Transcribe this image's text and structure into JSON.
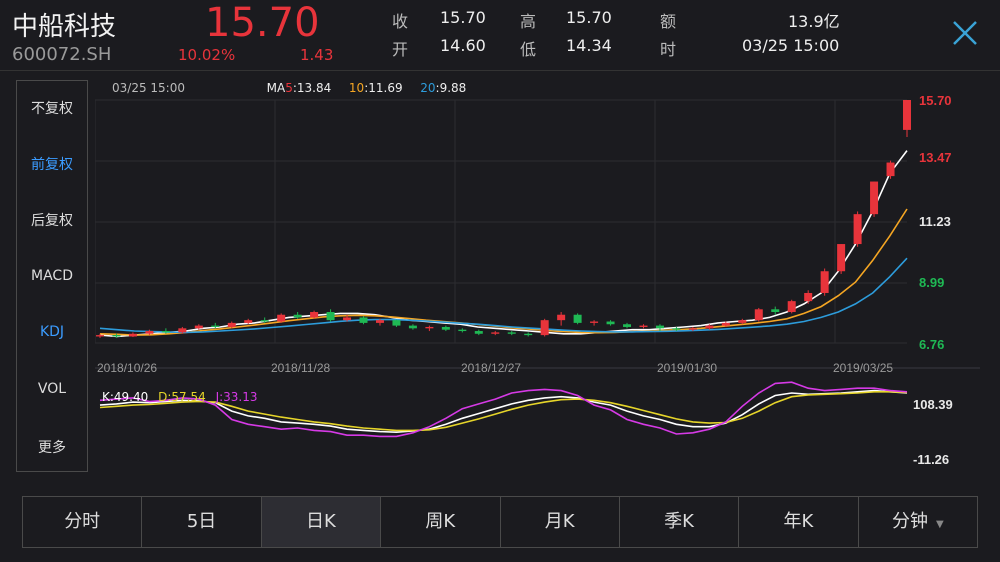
{
  "header": {
    "name": "中船科技",
    "code": "600072.SH",
    "price": "15.70",
    "change_pct": "10.02%",
    "change_abs": "1.43",
    "quotes": [
      {
        "label": "收",
        "value": "15.70"
      },
      {
        "label": "高",
        "value": "15.70"
      },
      {
        "label": "额",
        "value": "13.9亿"
      },
      {
        "label": "开",
        "value": "14.60"
      },
      {
        "label": "低",
        "value": "14.34"
      },
      {
        "label": "时",
        "value": "03/25 15:00"
      }
    ],
    "close_icon": "close-icon"
  },
  "side_menu": {
    "items": [
      "不复权",
      "前复权",
      "后复权",
      "MACD",
      "KDJ",
      "VOL",
      "更多"
    ],
    "active": [
      "前复权",
      "KDJ"
    ]
  },
  "info_bar": {
    "time": "03/25 15:00",
    "ma_prefix": "MA",
    "ma5_key": "5",
    "ma5_val": ":13.84",
    "ma10_key": "10",
    "ma10_val": ":11.69",
    "ma20_key": "20",
    "ma20_val": ":9.88"
  },
  "kdj_info": {
    "k": "K:49.40",
    "d": "D:57.54",
    "j": "J:33.13"
  },
  "tabs": {
    "items": [
      "分时",
      "5日",
      "日K",
      "周K",
      "月K",
      "季K",
      "年K",
      "分钟"
    ],
    "active": "日K",
    "dropdown_icon": "caret-down-icon"
  },
  "colors": {
    "up": "#e8343b",
    "down": "#1fb954",
    "ma5": "#ffffff",
    "ma10": "#f5a623",
    "ma20": "#2d9cdb",
    "k": "#ffffff",
    "d": "#e6d52a",
    "j": "#d63ae6",
    "active": "#3b9cff"
  },
  "chart_data": [
    {
      "type": "candlestick",
      "y_ticks": [
        "15.70",
        "13.47",
        "11.23",
        "8.99",
        "6.76"
      ],
      "ylim": [
        6.76,
        15.7
      ],
      "x_labels": [
        "2018/10/26",
        "2018/11/28",
        "2018/12/27",
        "2019/01/30",
        "2019/03/25"
      ],
      "series": [
        {
          "name": "MA5",
          "values": [
            7.05,
            7.0,
            7.05,
            7.1,
            7.15,
            7.2,
            7.3,
            7.35,
            7.45,
            7.5,
            7.6,
            7.7,
            7.75,
            7.8,
            7.85,
            7.85,
            7.8,
            7.7,
            7.6,
            7.55,
            7.5,
            7.45,
            7.35,
            7.3,
            7.25,
            7.2,
            7.15,
            7.1,
            7.1,
            7.15,
            7.2,
            7.25,
            7.25,
            7.3,
            7.35,
            7.4,
            7.5,
            7.55,
            7.6,
            7.7,
            7.9,
            8.2,
            8.6,
            9.4,
            10.4,
            11.6,
            13.0,
            13.84
          ]
        },
        {
          "name": "MA10",
          "values": [
            7.1,
            7.08,
            7.05,
            7.06,
            7.1,
            7.15,
            7.22,
            7.28,
            7.35,
            7.42,
            7.5,
            7.58,
            7.65,
            7.72,
            7.76,
            7.78,
            7.76,
            7.72,
            7.66,
            7.6,
            7.55,
            7.5,
            7.44,
            7.38,
            7.32,
            7.27,
            7.22,
            7.18,
            7.15,
            7.14,
            7.15,
            7.18,
            7.2,
            7.23,
            7.26,
            7.3,
            7.36,
            7.42,
            7.48,
            7.55,
            7.65,
            7.85,
            8.1,
            8.5,
            9.0,
            9.8,
            10.7,
            11.69
          ]
        },
        {
          "name": "MA20",
          "values": [
            7.3,
            7.25,
            7.2,
            7.18,
            7.16,
            7.15,
            7.17,
            7.2,
            7.24,
            7.28,
            7.33,
            7.38,
            7.44,
            7.5,
            7.56,
            7.6,
            7.62,
            7.62,
            7.6,
            7.57,
            7.53,
            7.49,
            7.45,
            7.4,
            7.35,
            7.31,
            7.27,
            7.23,
            7.2,
            7.18,
            7.17,
            7.17,
            7.18,
            7.19,
            7.21,
            7.23,
            7.26,
            7.3,
            7.34,
            7.39,
            7.45,
            7.55,
            7.7,
            7.9,
            8.2,
            8.6,
            9.2,
            9.88
          ]
        }
      ],
      "candles": [
        [
          7.0,
          7.05,
          6.95,
          7.1
        ],
        [
          7.05,
          7.0,
          6.95,
          7.1
        ],
        [
          7.0,
          7.1,
          6.98,
          7.15
        ],
        [
          7.1,
          7.2,
          7.05,
          7.25
        ],
        [
          7.2,
          7.15,
          7.1,
          7.3
        ],
        [
          7.15,
          7.3,
          7.1,
          7.35
        ],
        [
          7.3,
          7.4,
          7.25,
          7.45
        ],
        [
          7.4,
          7.35,
          7.3,
          7.5
        ],
        [
          7.35,
          7.5,
          7.3,
          7.55
        ],
        [
          7.5,
          7.6,
          7.45,
          7.65
        ],
        [
          7.6,
          7.55,
          7.5,
          7.7
        ],
        [
          7.55,
          7.8,
          7.5,
          7.85
        ],
        [
          7.8,
          7.7,
          7.65,
          7.9
        ],
        [
          7.7,
          7.9,
          7.65,
          7.95
        ],
        [
          7.9,
          7.6,
          7.55,
          8.0
        ],
        [
          7.6,
          7.7,
          7.55,
          7.8
        ],
        [
          7.7,
          7.5,
          7.45,
          7.75
        ],
        [
          7.5,
          7.6,
          7.4,
          7.65
        ],
        [
          7.6,
          7.4,
          7.35,
          7.62
        ],
        [
          7.4,
          7.3,
          7.25,
          7.45
        ],
        [
          7.3,
          7.35,
          7.2,
          7.4
        ],
        [
          7.35,
          7.25,
          7.2,
          7.4
        ],
        [
          7.25,
          7.2,
          7.15,
          7.3
        ],
        [
          7.2,
          7.1,
          7.05,
          7.25
        ],
        [
          7.1,
          7.15,
          7.05,
          7.2
        ],
        [
          7.15,
          7.1,
          7.05,
          7.2
        ],
        [
          7.1,
          7.05,
          7.0,
          7.15
        ],
        [
          7.05,
          7.6,
          7.0,
          7.65
        ],
        [
          7.6,
          7.8,
          7.4,
          7.9
        ],
        [
          7.8,
          7.5,
          7.45,
          7.85
        ],
        [
          7.5,
          7.55,
          7.4,
          7.6
        ],
        [
          7.55,
          7.45,
          7.4,
          7.6
        ],
        [
          7.45,
          7.35,
          7.3,
          7.5
        ],
        [
          7.35,
          7.4,
          7.3,
          7.45
        ],
        [
          7.4,
          7.3,
          7.2,
          7.45
        ],
        [
          7.3,
          7.25,
          7.2,
          7.35
        ],
        [
          7.25,
          7.3,
          7.2,
          7.35
        ],
        [
          7.3,
          7.4,
          7.25,
          7.45
        ],
        [
          7.4,
          7.5,
          7.35,
          7.55
        ],
        [
          7.5,
          7.6,
          7.45,
          7.65
        ],
        [
          7.6,
          8.0,
          7.55,
          8.05
        ],
        [
          8.0,
          7.9,
          7.8,
          8.1
        ],
        [
          7.9,
          8.3,
          7.85,
          8.35
        ],
        [
          8.3,
          8.6,
          8.2,
          8.7
        ],
        [
          8.6,
          9.4,
          8.5,
          9.5
        ],
        [
          9.4,
          10.4,
          9.3,
          10.4
        ],
        [
          10.4,
          11.5,
          10.3,
          11.6
        ],
        [
          11.5,
          12.7,
          11.4,
          12.7
        ]
      ],
      "last_candles": [
        [
          12.9,
          13.4,
          12.8,
          13.47
        ],
        [
          14.6,
          15.7,
          14.34,
          15.7
        ]
      ]
    },
    {
      "type": "line",
      "y_ticks": [
        "108.39",
        "-11.26"
      ],
      "ylim": [
        -11.26,
        108.39
      ],
      "series": [
        {
          "name": "K",
          "values": [
            80,
            82,
            85,
            84,
            86,
            88,
            87,
            84,
            70,
            62,
            58,
            52,
            50,
            48,
            45,
            40,
            38,
            36,
            35,
            37,
            40,
            48,
            58,
            66,
            74,
            82,
            88,
            92,
            94,
            92,
            85,
            80,
            70,
            62,
            56,
            48,
            44,
            44,
            50,
            64,
            82,
            96,
            100,
            98,
            99,
            100,
            102,
            104,
            102,
            100
          ]
        },
        {
          "name": "D",
          "values": [
            76,
            78,
            80,
            81,
            83,
            85,
            86,
            85,
            78,
            70,
            65,
            60,
            56,
            52,
            49,
            45,
            42,
            40,
            38,
            38,
            39,
            43,
            50,
            57,
            65,
            73,
            80,
            85,
            89,
            90,
            88,
            84,
            78,
            71,
            64,
            57,
            52,
            50,
            51,
            58,
            70,
            84,
            94,
            97,
            98,
            99,
            100,
            102,
            102,
            101
          ]
        },
        {
          "name": "J",
          "values": [
            88,
            90,
            92,
            86,
            88,
            92,
            90,
            80,
            56,
            48,
            44,
            40,
            42,
            38,
            36,
            30,
            30,
            28,
            28,
            34,
            44,
            58,
            74,
            82,
            90,
            100,
            104,
            106,
            104,
            96,
            80,
            72,
            56,
            48,
            42,
            32,
            34,
            40,
            52,
            78,
            100,
            116,
            118,
            108,
            104,
            106,
            108,
            108,
            104,
            102
          ]
        }
      ]
    }
  ]
}
